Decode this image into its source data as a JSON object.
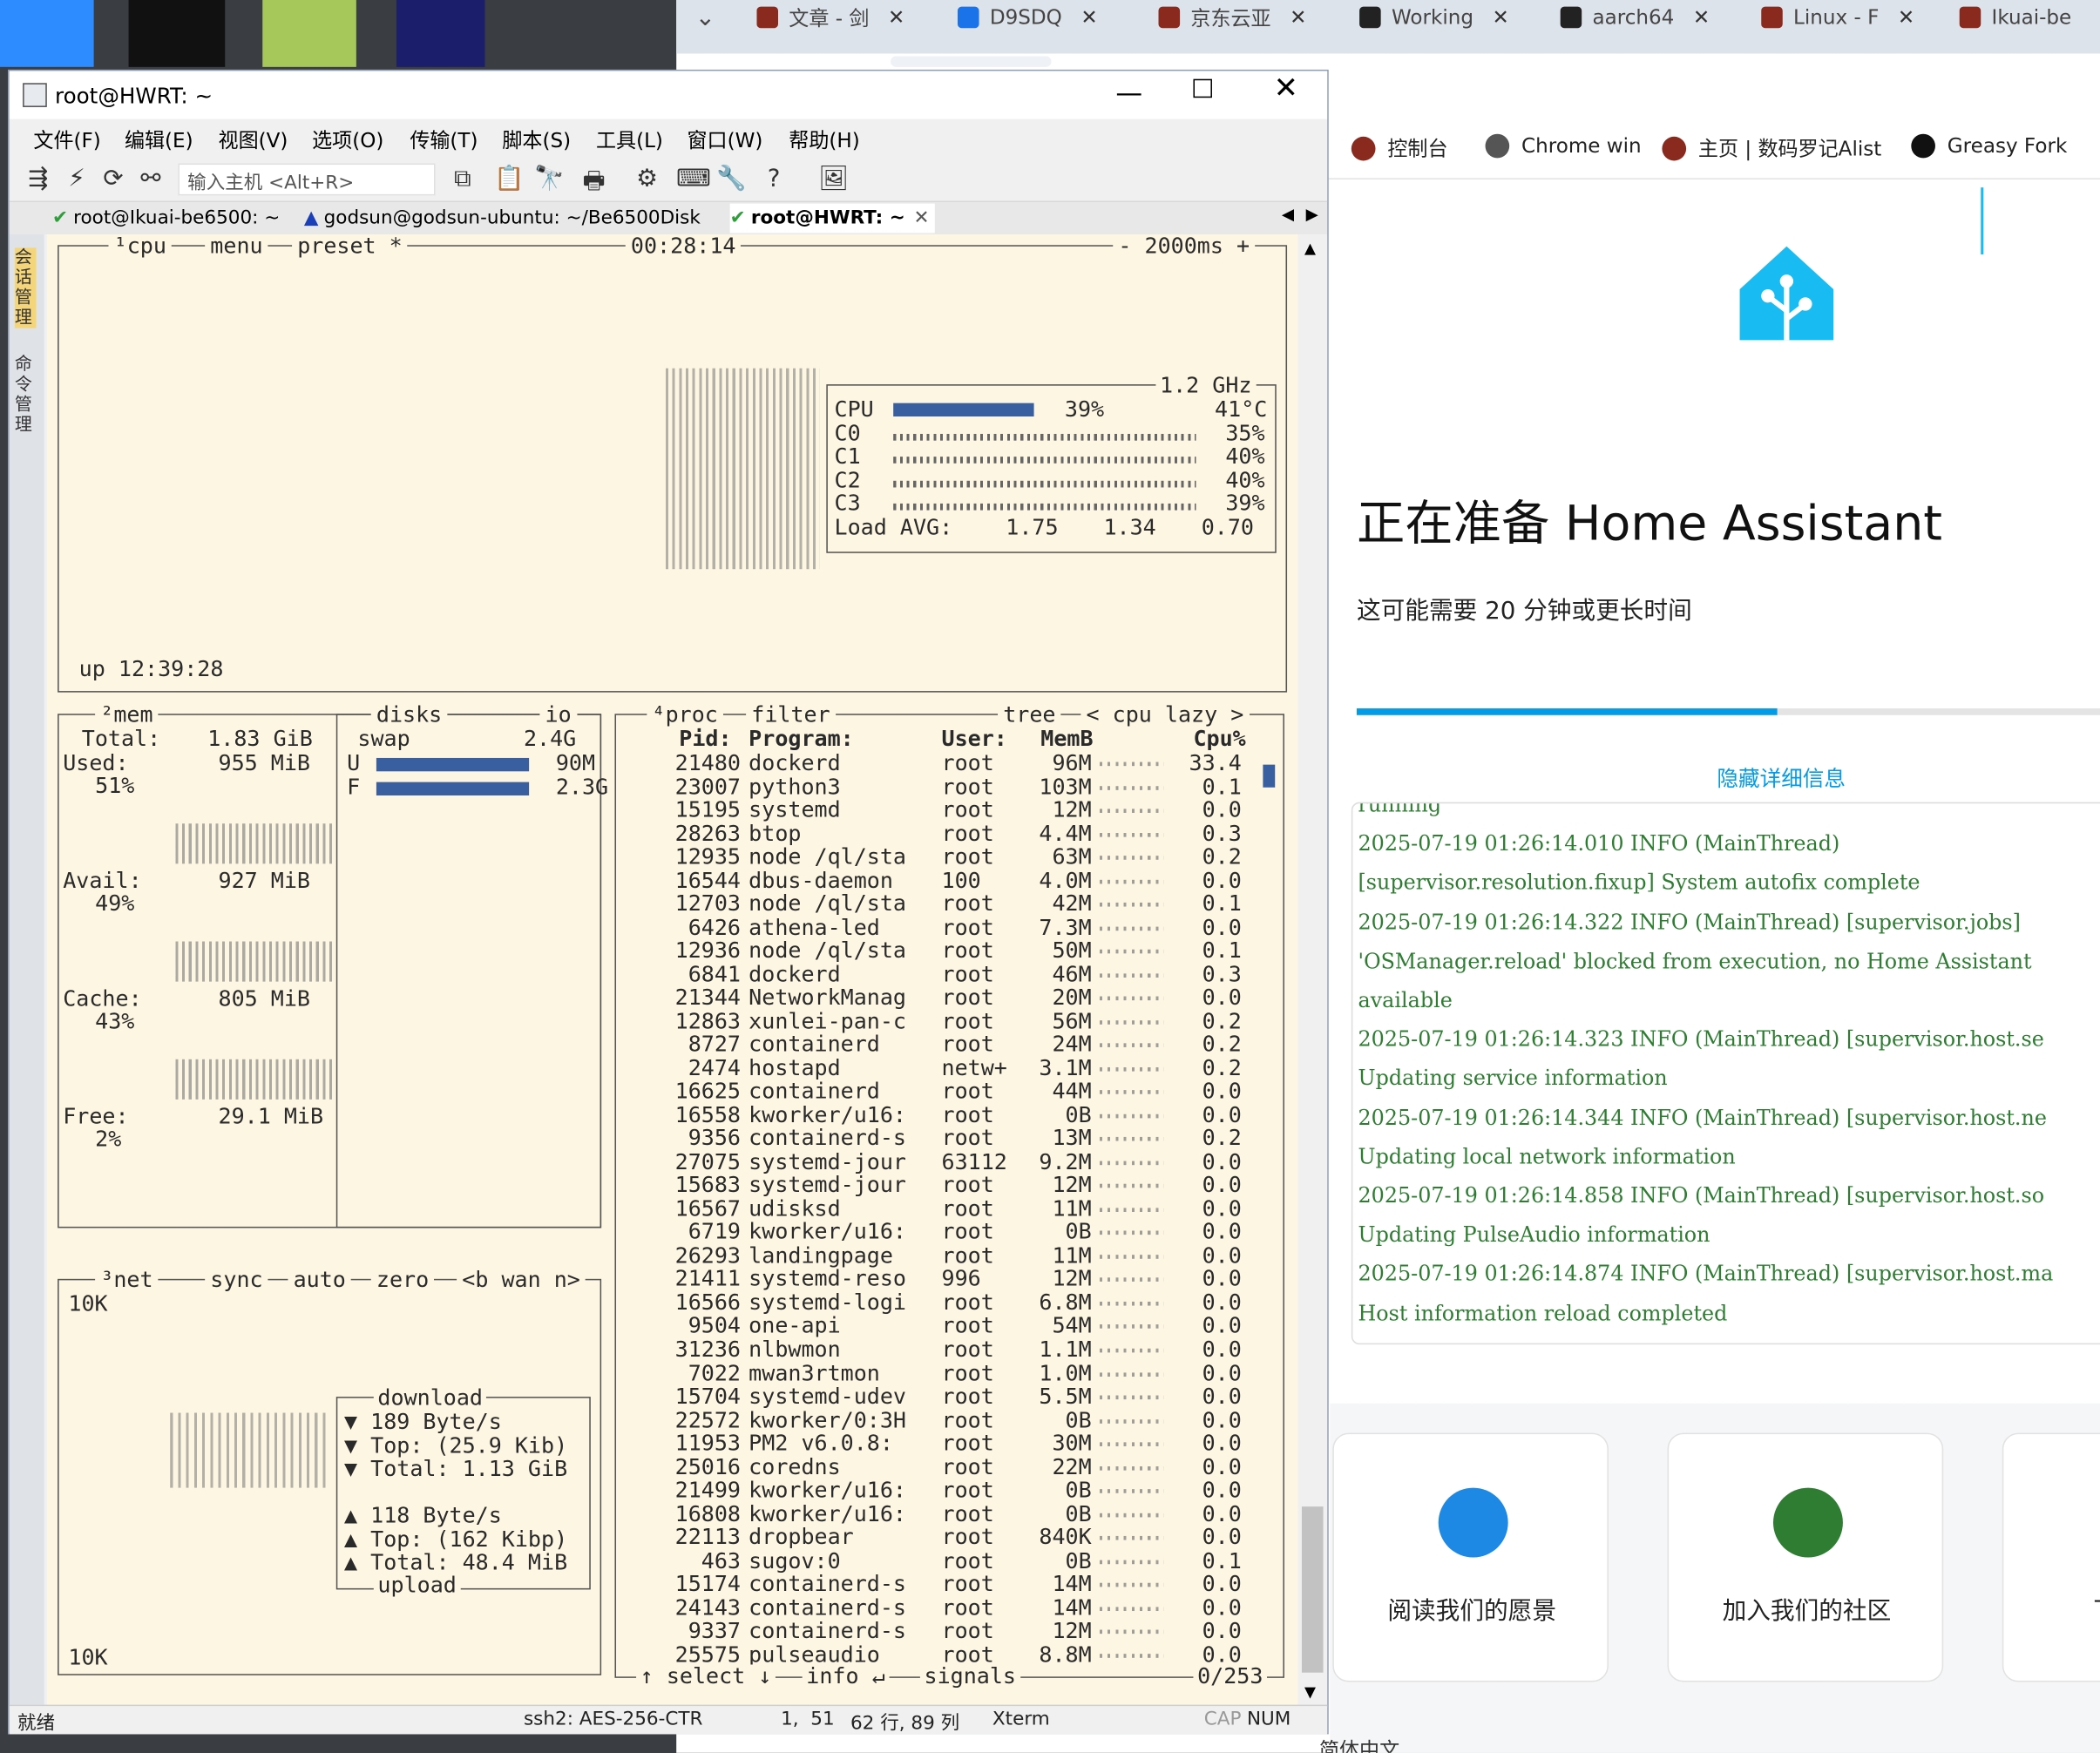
{
  "desktop": {
    "icons": [
      "zoom-app",
      "tiktok-app",
      "notepad-app",
      "hex-editor-app"
    ]
  },
  "browser": {
    "tabs": [
      {
        "title": "文章 - 剑",
        "icon": "app-icon"
      },
      {
        "title": "D9SDQ",
        "icon": "search-icon"
      },
      {
        "title": "京东云亚",
        "icon": "app-icon"
      },
      {
        "title": "Working",
        "icon": "github-icon"
      },
      {
        "title": "aarch64",
        "icon": "github-icon"
      },
      {
        "title": "Linux - F",
        "icon": "app-icon"
      },
      {
        "title": "Ikuai-be",
        "icon": "app-icon"
      }
    ],
    "bookmarks": [
      "控制台",
      "Chrome win",
      "主页 | 数码罗记Alist",
      "Greasy Fork"
    ],
    "bottom_text": "简体中文"
  },
  "ha": {
    "title": "正在准备 Home Assistant",
    "subtitle": "这可能需要 20 分钟或更长时间",
    "progress": 0.56,
    "toggle_details": "隐藏详细信息",
    "log": [
      "running",
      "2025-07-19 01:26:14.010 INFO (MainThread)",
      "[supervisor.resolution.fixup] System autofix complete",
      "2025-07-19 01:26:14.322 INFO (MainThread) [supervisor.jobs]",
      "'OSManager.reload' blocked from execution, no Home Assistant",
      "available",
      "2025-07-19 01:26:14.323 INFO (MainThread) [supervisor.host.se",
      "Updating service information",
      "2025-07-19 01:26:14.344 INFO (MainThread) [supervisor.host.ne",
      "Updating local network information",
      "2025-07-19 01:26:14.858 INFO (MainThread) [supervisor.host.so",
      "Updating PulseAudio information",
      "2025-07-19 01:26:14.874 INFO (MainThread) [supervisor.host.ma",
      "Host information reload completed"
    ],
    "cards": [
      {
        "label": "阅读我们的愿景",
        "color": "#1e88e5"
      },
      {
        "label": "加入我们的社区",
        "color": "#2e7d32"
      },
      {
        "label": "下载我们",
        "color": "#7e57c2"
      }
    ],
    "brand_color": "#18bcf2"
  },
  "putty": {
    "title": "root@HWRT: ~",
    "menu": [
      "文件(F)",
      "编辑(E)",
      "视图(V)",
      "选项(O)",
      "传输(T)",
      "脚本(S)",
      "工具(L)",
      "窗口(W)",
      "帮助(H)"
    ],
    "host_placeholder": "输入主机 <Alt+R>",
    "session_tabs": [
      "root@Ikuai-be6500: ~",
      "godsun@godsun-ubuntu: ~/Be6500Disk",
      "root@HWRT: ~"
    ],
    "side_tabs": [
      "会话管理",
      "命令管理"
    ],
    "status": {
      "ready": "就绪",
      "cipher": "ssh2: AES-256-CTR",
      "pos": "1,  51",
      "size": "62 行, 89 列",
      "term": "Xterm",
      "cap": "CAP",
      "num": "NUM"
    }
  },
  "btop": {
    "header": {
      "cpu": "¹cpu",
      "menu": "menu",
      "preset": "preset *",
      "clock": "00:28:14",
      "interval": "- 2000ms +"
    },
    "cpu": {
      "freq": "1.2 GHz",
      "rows": [
        {
          "label": "CPU",
          "pct": "39%",
          "temp": "41°C",
          "value": 39
        },
        {
          "label": "C0",
          "pct": "35%",
          "value": 35
        },
        {
          "label": "C1",
          "pct": "40%",
          "value": 40
        },
        {
          "label": "C2",
          "pct": "40%",
          "value": 40
        },
        {
          "label": "C3",
          "pct": "39%",
          "value": 39
        }
      ],
      "load_label": "Load AVG:",
      "load": [
        "1.75",
        "1.34",
        "0.70"
      ],
      "uptime": "up 12:39:28"
    },
    "mem": {
      "title": "²mem",
      "total_label": "Total:",
      "total": "1.83 GiB",
      "items": [
        {
          "label": "Used:",
          "value": "955 MiB",
          "pct": "51%"
        },
        {
          "label": "Avail:",
          "value": "927 MiB",
          "pct": "49%"
        },
        {
          "label": "Cache:",
          "value": "805 MiB",
          "pct": "43%"
        },
        {
          "label": "Free:",
          "value": "29.1 MiB",
          "pct": "2%"
        }
      ]
    },
    "disks": {
      "title": "disks",
      "io": "io",
      "swap": "swap",
      "swap_total": "2.4G",
      "rows": [
        {
          "label": "U",
          "value": "90M"
        },
        {
          "label": "F",
          "value": "2.3G"
        }
      ]
    },
    "net": {
      "title": "³net",
      "sync": "sync",
      "auto": "auto",
      "zero": "zero",
      "iface": "<b wan n>",
      "scale_top": "10K",
      "scale_bottom": "10K",
      "download_title": "download",
      "download": [
        "▼ 189 Byte/s",
        "▼ Top: (25.9 Kib)",
        "▼ Total: 1.13 GiB"
      ],
      "upload": [
        "▲ 118 Byte/s",
        "▲ Top: (162 Kibp)",
        "▲ Total: 48.4 MiB"
      ],
      "upload_title": "upload"
    },
    "proc": {
      "title": "⁴proc",
      "filter": "filter",
      "tree": "tree",
      "sort": "< cpu lazy >",
      "headers": [
        "Pid:",
        "Program:",
        "User:",
        "MemB",
        "Cpu%"
      ],
      "footer": {
        "select": "↑ select ↓",
        "info": "info ↵",
        "signals": "signals",
        "count": "0/253"
      },
      "rows": [
        [
          "21480",
          "dockerd",
          "root",
          "96M",
          "33.4"
        ],
        [
          "23007",
          "python3",
          "root",
          "103M",
          "0.1"
        ],
        [
          "15195",
          "systemd",
          "root",
          "12M",
          "0.0"
        ],
        [
          "28263",
          "btop",
          "root",
          "4.4M",
          "0.3"
        ],
        [
          "12935",
          "node /ql/sta",
          "root",
          "63M",
          "0.2"
        ],
        [
          "16544",
          "dbus-daemon",
          "100",
          "4.0M",
          "0.0"
        ],
        [
          "12703",
          "node /ql/sta",
          "root",
          "42M",
          "0.1"
        ],
        [
          "6426",
          "athena-led",
          "root",
          "7.3M",
          "0.0"
        ],
        [
          "12936",
          "node /ql/sta",
          "root",
          "50M",
          "0.1"
        ],
        [
          "6841",
          "dockerd",
          "root",
          "46M",
          "0.3"
        ],
        [
          "21344",
          "NetworkManag",
          "root",
          "20M",
          "0.0"
        ],
        [
          "12863",
          "xunlei-pan-c",
          "root",
          "56M",
          "0.2"
        ],
        [
          "8727",
          "containerd",
          "root",
          "24M",
          "0.2"
        ],
        [
          "2474",
          "hostapd",
          "netw+",
          "3.1M",
          "0.2"
        ],
        [
          "16625",
          "containerd",
          "root",
          "44M",
          "0.0"
        ],
        [
          "16558",
          "kworker/u16:",
          "root",
          "0B",
          "0.0"
        ],
        [
          "9356",
          "containerd-s",
          "root",
          "13M",
          "0.2"
        ],
        [
          "27075",
          "systemd-jour",
          "63112",
          "9.2M",
          "0.0"
        ],
        [
          "15683",
          "systemd-jour",
          "root",
          "12M",
          "0.0"
        ],
        [
          "16567",
          "udisksd",
          "root",
          "11M",
          "0.0"
        ],
        [
          "6719",
          "kworker/u16:",
          "root",
          "0B",
          "0.0"
        ],
        [
          "26293",
          "landingpage",
          "root",
          "11M",
          "0.0"
        ],
        [
          "21411",
          "systemd-reso",
          "996",
          "12M",
          "0.0"
        ],
        [
          "16566",
          "systemd-logi",
          "root",
          "6.8M",
          "0.0"
        ],
        [
          "9504",
          "one-api",
          "root",
          "54M",
          "0.0"
        ],
        [
          "31236",
          "nlbwmon",
          "root",
          "1.1M",
          "0.0"
        ],
        [
          "7022",
          "mwan3rtmon",
          "root",
          "1.0M",
          "0.0"
        ],
        [
          "15704",
          "systemd-udev",
          "root",
          "5.5M",
          "0.0"
        ],
        [
          "22572",
          "kworker/0:3H",
          "root",
          "0B",
          "0.0"
        ],
        [
          "11953",
          "PM2 v6.0.8:",
          "root",
          "30M",
          "0.0"
        ],
        [
          "25016",
          "coredns",
          "root",
          "22M",
          "0.0"
        ],
        [
          "21499",
          "kworker/u16:",
          "root",
          "0B",
          "0.0"
        ],
        [
          "16808",
          "kworker/u16:",
          "root",
          "0B",
          "0.0"
        ],
        [
          "22113",
          "dropbear",
          "root",
          "840K",
          "0.0"
        ],
        [
          "463",
          "sugov:0",
          "root",
          "0B",
          "0.1"
        ],
        [
          "15174",
          "containerd-s",
          "root",
          "14M",
          "0.0"
        ],
        [
          "24143",
          "containerd-s",
          "root",
          "14M",
          "0.0"
        ],
        [
          "9337",
          "containerd-s",
          "root",
          "12M",
          "0.0"
        ],
        [
          "25575",
          "pulseaudio",
          "root",
          "8.8M",
          "0.0"
        ]
      ]
    }
  }
}
